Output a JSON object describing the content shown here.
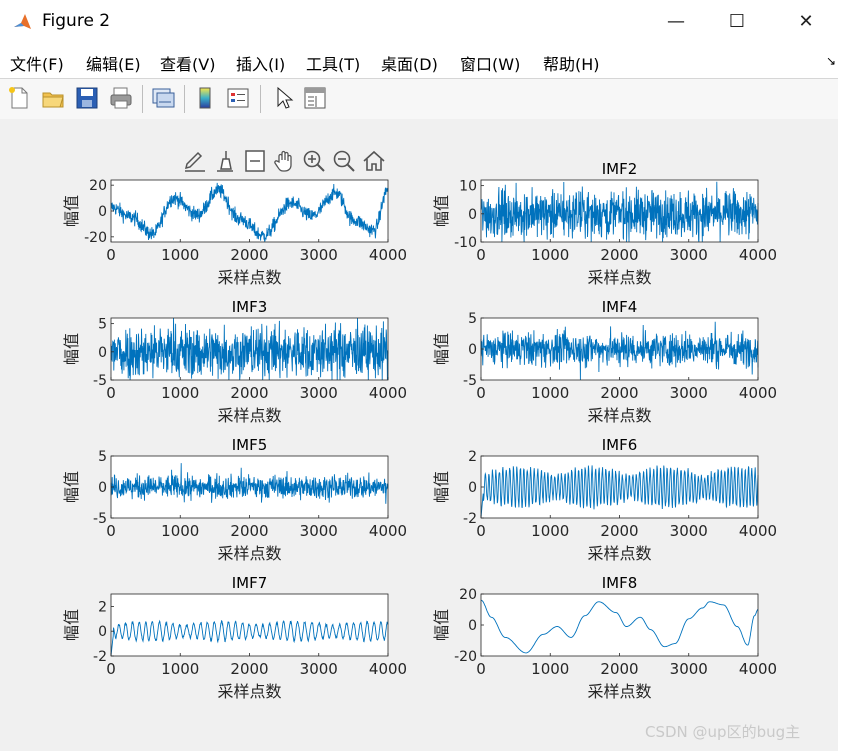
{
  "window": {
    "title": "Figure 2",
    "minimize_glyph": "—",
    "maximize_glyph": "☐",
    "close_glyph": "✕"
  },
  "menu": {
    "items": [
      "文件(F)",
      "编辑(E)",
      "查看(V)",
      "插入(I)",
      "工具(T)",
      "桌面(D)",
      "窗口(W)",
      "帮助(H)"
    ],
    "dock_glyph": "↘"
  },
  "toolbar": {
    "icons": [
      "new-figure-icon",
      "open-file-icon",
      "save-icon",
      "print-icon",
      "link-plot-icon",
      "insert-colorbar-icon",
      "insert-legend-icon",
      "edit-plot-arrow-icon",
      "property-inspector-icon"
    ]
  },
  "axes_toolbar": {
    "icons": [
      "brush-edit-icon",
      "data-brush-icon",
      "data-tips-icon",
      "pan-hand-icon",
      "zoom-in-icon",
      "zoom-out-icon",
      "restore-view-icon"
    ]
  },
  "colors": {
    "line": "#0072bd",
    "axis": "#262626",
    "tick_text": "#262626"
  },
  "chart_data": [
    {
      "type": "line",
      "title": "",
      "xlabel": "采样点数",
      "ylabel": "幅值",
      "xlim": [
        0,
        4000
      ],
      "ylim": [
        -24,
        24
      ],
      "xticks": [
        0,
        1000,
        2000,
        3000,
        4000
      ],
      "yticks": [
        20,
        0,
        -20
      ],
      "ytick_labels": [
        "20",
        "0",
        "-20"
      ],
      "series": [
        {
          "kind": "sine_noise",
          "amp": 13,
          "period": 620,
          "phase": 0.3,
          "noise": 5,
          "offset": 0,
          "points": [
            [
              0,
              3
            ],
            [
              300,
              -5
            ],
            [
              600,
              -18
            ],
            [
              900,
              10
            ],
            [
              1250,
              -3
            ],
            [
              1550,
              16
            ],
            [
              1850,
              -6
            ],
            [
              2200,
              -19
            ],
            [
              2600,
              6
            ],
            [
              2900,
              -4
            ],
            [
              3250,
              14
            ],
            [
              3500,
              -7
            ],
            [
              3800,
              -15
            ],
            [
              4000,
              17
            ]
          ]
        }
      ]
    },
    {
      "type": "line",
      "title": "IMF2",
      "xlabel": "采样点数",
      "ylabel": "幅值",
      "xlim": [
        0,
        4000
      ],
      "ylim": [
        -10,
        12
      ],
      "xticks": [
        0,
        1000,
        2000,
        3000,
        4000
      ],
      "yticks": [
        10,
        0,
        -10
      ],
      "ytick_labels": [
        "10",
        "0",
        "-10"
      ],
      "series": [
        {
          "kind": "noise",
          "amp": 8,
          "range": [
            -10,
            12
          ]
        }
      ]
    },
    {
      "type": "line",
      "title": "IMF3",
      "xlabel": "采样点数",
      "ylabel": "幅值",
      "xlim": [
        0,
        4000
      ],
      "ylim": [
        -5,
        6
      ],
      "xticks": [
        0,
        1000,
        2000,
        3000,
        4000
      ],
      "yticks": [
        5,
        0,
        -5
      ],
      "ytick_labels": [
        "5",
        "0",
        "-5"
      ],
      "series": [
        {
          "kind": "noise",
          "amp": 4.5,
          "range": [
            -5,
            6
          ]
        }
      ]
    },
    {
      "type": "line",
      "title": "IMF4",
      "xlabel": "采样点数",
      "ylabel": "幅值",
      "xlim": [
        0,
        4000
      ],
      "ylim": [
        -5,
        5
      ],
      "xticks": [
        0,
        1000,
        2000,
        3000,
        4000
      ],
      "yticks": [
        5,
        0,
        -5
      ],
      "ytick_labels": [
        "5",
        "0",
        "-5"
      ],
      "series": [
        {
          "kind": "noise",
          "amp": 2.6,
          "range": [
            -5,
            5
          ]
        }
      ]
    },
    {
      "type": "line",
      "title": "IMF5",
      "xlabel": "采样点数",
      "ylabel": "幅值",
      "xlim": [
        0,
        4000
      ],
      "ylim": [
        -5,
        5
      ],
      "xticks": [
        0,
        1000,
        2000,
        3000,
        4000
      ],
      "yticks": [
        5,
        0,
        -5
      ],
      "ytick_labels": [
        "5",
        "0",
        "-5"
      ],
      "series": [
        {
          "kind": "noise",
          "amp": 1.8,
          "range": [
            -5,
            5
          ]
        }
      ]
    },
    {
      "type": "line",
      "title": "IMF6",
      "xlabel": "采样点数",
      "ylabel": "幅值",
      "xlim": [
        0,
        4000
      ],
      "ylim": [
        -2,
        2
      ],
      "xticks": [
        0,
        1000,
        2000,
        3000,
        4000
      ],
      "yticks": [
        2,
        0,
        -2
      ],
      "ytick_labels": [
        "2",
        "0",
        "-2"
      ],
      "series": [
        {
          "kind": "wiggle",
          "amp": 0.9,
          "freq": 0.09,
          "range": [
            -2,
            2
          ]
        }
      ]
    },
    {
      "type": "line",
      "title": "IMF7",
      "xlabel": "采样点数",
      "ylabel": "幅值",
      "xlim": [
        0,
        4000
      ],
      "ylim": [
        -2,
        3
      ],
      "xticks": [
        0,
        1000,
        2000,
        3000,
        4000
      ],
      "yticks": [
        2,
        0,
        -2
      ],
      "ytick_labels": [
        "2",
        "0",
        "-2"
      ],
      "series": [
        {
          "kind": "wiggle",
          "amp": 0.55,
          "freq": 0.045,
          "range": [
            -2,
            3
          ]
        }
      ]
    },
    {
      "type": "line",
      "title": "IMF8",
      "xlabel": "采样点数",
      "ylabel": "幅值",
      "xlim": [
        0,
        4000
      ],
      "ylim": [
        -20,
        20
      ],
      "xticks": [
        0,
        1000,
        2000,
        3000,
        4000
      ],
      "yticks": [
        20,
        0,
        -20
      ],
      "ytick_labels": [
        "20",
        "0",
        "-20"
      ],
      "series": [
        {
          "kind": "smooth",
          "points": [
            [
              0,
              16
            ],
            [
              150,
              5
            ],
            [
              350,
              -8
            ],
            [
              650,
              -18
            ],
            [
              900,
              -6
            ],
            [
              1100,
              -1
            ],
            [
              1300,
              -8
            ],
            [
              1500,
              6
            ],
            [
              1700,
              15
            ],
            [
              1950,
              8
            ],
            [
              2100,
              -1
            ],
            [
              2300,
              5
            ],
            [
              2450,
              -3
            ],
            [
              2650,
              -14
            ],
            [
              2800,
              -12
            ],
            [
              3000,
              4
            ],
            [
              3200,
              11
            ],
            [
              3300,
              15
            ],
            [
              3500,
              13
            ],
            [
              3700,
              -1
            ],
            [
              3850,
              -13
            ],
            [
              3950,
              6
            ],
            [
              4000,
              10
            ]
          ]
        }
      ]
    }
  ],
  "watermark": "CSDN @up区的bug主"
}
